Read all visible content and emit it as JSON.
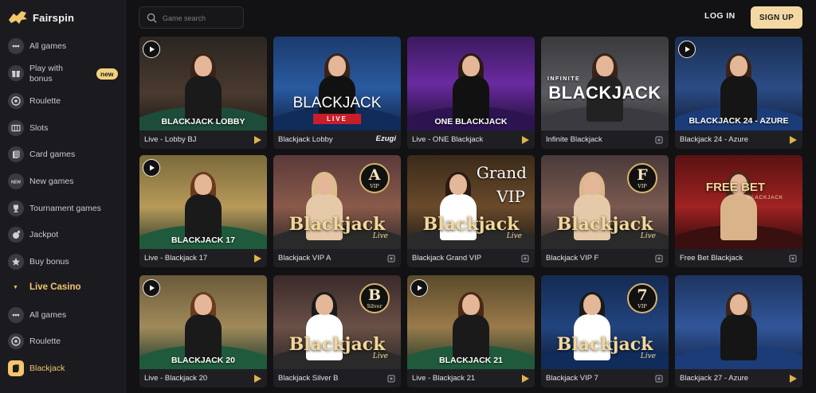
{
  "brand": {
    "name": "Fairspin",
    "accent": "#f2c66b",
    "signup_bg": "#f3d8a4"
  },
  "header": {
    "search_placeholder": "Game search",
    "login_label": "LOG IN",
    "signup_label": "SIGN UP"
  },
  "sidebar": {
    "items": [
      {
        "label": "All games",
        "icon": "dots-icon"
      },
      {
        "label": "Play with\nbonus",
        "icon": "gift-icon",
        "badge": "new"
      },
      {
        "label": "Roulette",
        "icon": "roulette-icon"
      },
      {
        "label": "Slots",
        "icon": "slots-icon"
      },
      {
        "label": "Card games",
        "icon": "cards-icon"
      },
      {
        "label": "New games",
        "icon": "new-icon",
        "icon_text": "NEW"
      },
      {
        "label": "Tournament games",
        "icon": "trophy-icon"
      },
      {
        "label": "Jackpot",
        "icon": "jackpot-icon"
      },
      {
        "label": "Buy bonus",
        "icon": "star-icon"
      }
    ],
    "section": {
      "label": "Live Casino"
    },
    "live_items": [
      {
        "label": "All games",
        "icon": "dots-icon"
      },
      {
        "label": "Roulette",
        "icon": "roulette-icon"
      },
      {
        "label": "Blackjack",
        "icon": "blackjack-icon",
        "active": true
      }
    ]
  },
  "games": [
    {
      "name": "Live - Lobby BJ",
      "thumb_title": "BLACKJACK LOBBY",
      "provider": "play-icon",
      "play_badge": true
    },
    {
      "name": "Blackjack Lobby",
      "thumb_title": "BLACKJACK",
      "thumb_sub": "LIVE",
      "provider": "Ezugi"
    },
    {
      "name": "Live - ONE Blackjack",
      "thumb_title": "ONE BLACKJACK",
      "provider": "play-icon"
    },
    {
      "name": "Infinite Blackjack",
      "thumb_title": "BLACKJACK",
      "thumb_pre": "INFINITE",
      "provider": "evolution-icon"
    },
    {
      "name": "Blackjack 24 - Azure",
      "thumb_title": "BLACKJACK 24 - AZURE",
      "provider": "play-icon",
      "play_badge": true
    },
    {
      "name": "Live - Blackjack 17",
      "thumb_title": "BLACKJACK 17",
      "provider": "play-icon",
      "play_badge": true
    },
    {
      "name": "Blackjack VIP A",
      "thumb_title": "Blackjack",
      "thumb_sub": "Live",
      "vip_letter": "A",
      "vip_sub": "VIP",
      "provider": "evolution-icon"
    },
    {
      "name": "Blackjack Grand VIP",
      "thumb_title": "Blackjack",
      "thumb_sub": "Live",
      "grand_line1": "Grand",
      "grand_line2": "VIP",
      "provider": "evolution-icon"
    },
    {
      "name": "Blackjack VIP F",
      "thumb_title": "Blackjack",
      "thumb_sub": "Live",
      "vip_letter": "F",
      "vip_sub": "VIP",
      "provider": "evolution-icon"
    },
    {
      "name": "Free Bet Blackjack",
      "thumb_title": "FREE BET",
      "thumb_sub": "BLACKJACK",
      "provider": "evolution-icon"
    },
    {
      "name": "Live - Blackjack 20",
      "thumb_title": "BLACKJACK 20",
      "provider": "play-icon",
      "play_badge": true
    },
    {
      "name": "Blackjack Silver B",
      "thumb_title": "Blackjack",
      "thumb_sub": "Live",
      "vip_letter": "B",
      "vip_sub": "Silver",
      "provider": "evolution-icon"
    },
    {
      "name": "Live - Blackjack 21",
      "thumb_title": "BLACKJACK 21",
      "provider": "play-icon",
      "play_badge": true
    },
    {
      "name": "Blackjack VIP 7",
      "thumb_title": "Blackjack",
      "thumb_sub": "Live",
      "vip_letter": "7",
      "vip_sub": "VIP",
      "provider": "evolution-icon"
    },
    {
      "name": "Blackjack 27 - Azure",
      "thumb_title": "",
      "provider": "play-icon"
    }
  ]
}
